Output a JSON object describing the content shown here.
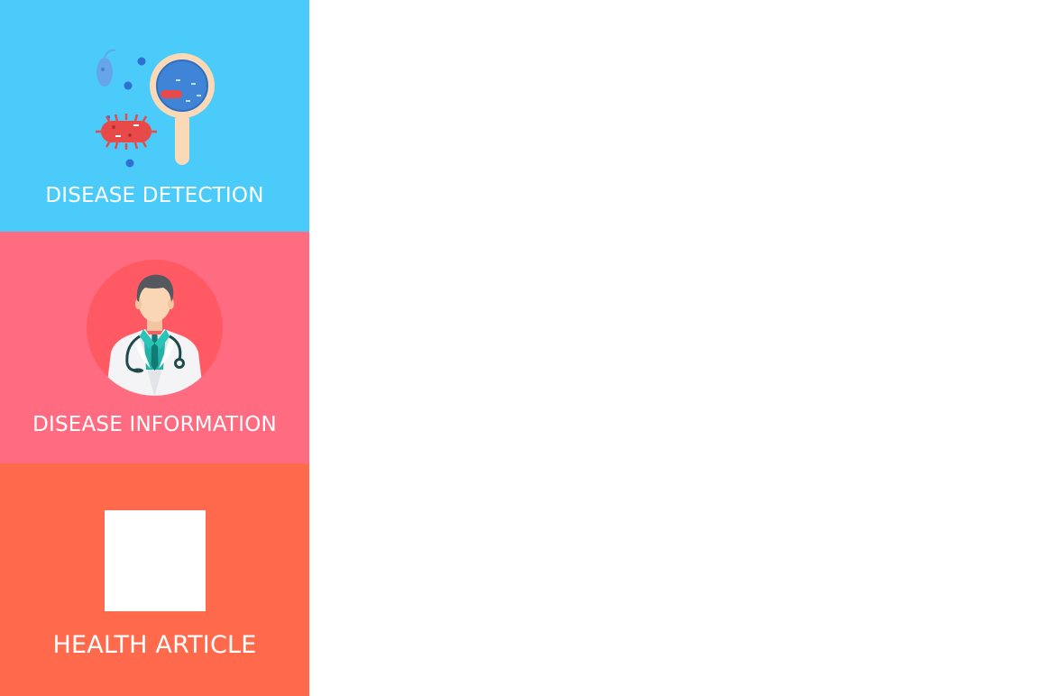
{
  "sidebar": {
    "items": [
      {
        "label": "DISEASE DETECTION",
        "icon": "magnifier-bacteria-icon",
        "color": "#4ACBFA"
      },
      {
        "label": "DISEASE INFORMATION",
        "icon": "doctor-icon",
        "color": "#FF6B80"
      },
      {
        "label": "HEALTH ARTICLE",
        "icon": "article-image-icon",
        "color": "#FF6A4C"
      }
    ]
  }
}
